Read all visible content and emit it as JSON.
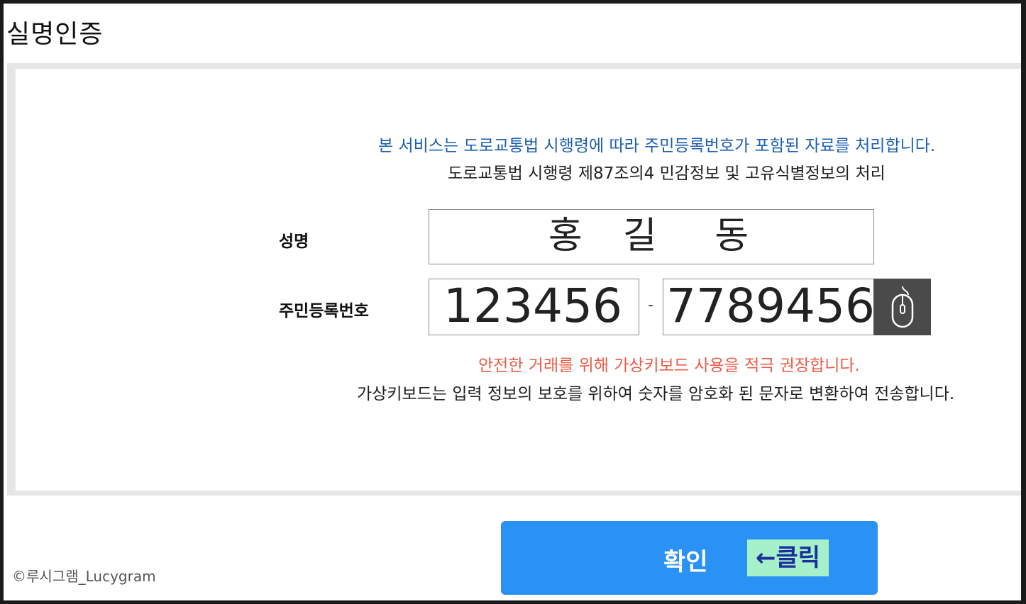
{
  "page": {
    "title": "실명인증"
  },
  "notice": {
    "service_text": "본 서비스는 도로교통법 시행령에 따라 주민등록번호가 포함된 자료를 처리합니다.",
    "law_text": "도로교통법 시행령 제87조의4 민감정보 및 고유식별정보의 처리"
  },
  "form": {
    "name_label": "성명",
    "name_value": "홍  길   동",
    "rrn_label": "주민등록번호",
    "rrn_front": "123456",
    "rrn_separator": "-",
    "rrn_back": "7789456",
    "keypad_icon": "mouse-icon"
  },
  "warnings": {
    "virtual_keyboard_recommend": "안전한 거래를 위해 가상키보드 사용을 적극 권장합니다.",
    "virtual_keyboard_desc": "가상키보드는 입력 정보의 보호를 위하여 숫자를 암호화 된 문자로 변환하여 전송합니다."
  },
  "actions": {
    "confirm_label": "확인",
    "click_hint": "←클릭"
  },
  "footer": {
    "copyright": "©루시그램_Lucygram"
  },
  "colors": {
    "blue_notice": "#1c5fb0",
    "red_warning": "#ec5b46",
    "confirm_button": "#2b92f5",
    "click_highlight": "#a6f1c9"
  }
}
